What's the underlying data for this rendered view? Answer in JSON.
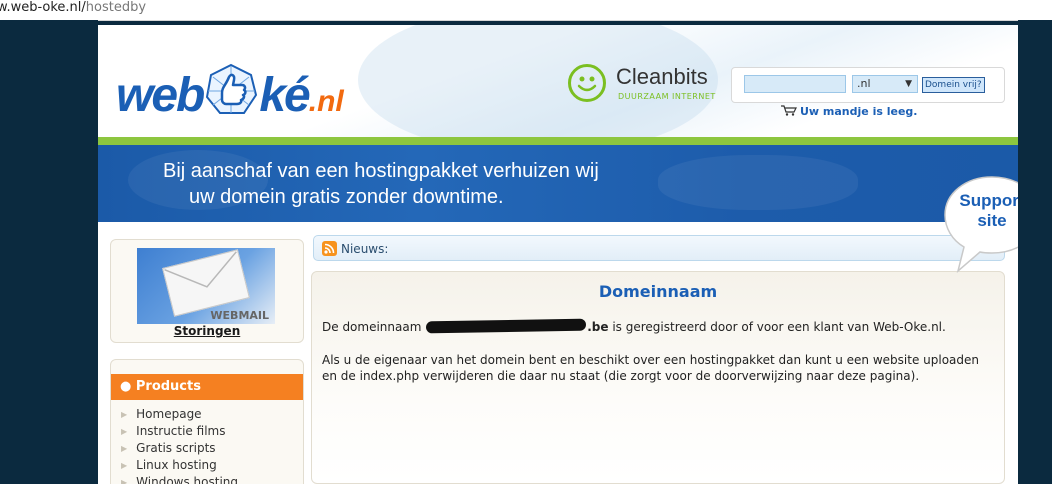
{
  "browser": {
    "url_host": "w.web-oke.nl/",
    "url_path": "hostedby"
  },
  "header": {
    "logo": {
      "part1": "web",
      "part2": "ké",
      "part3": ".nl"
    },
    "cleanbits": {
      "name": "Cleanbits",
      "tagline": "DUURZAAM INTERNET"
    },
    "domain_search": {
      "input_value": "",
      "tld_selected": ".nl",
      "button_label": "Domein vrij?"
    },
    "cart_text": "Uw mandje is leeg."
  },
  "banner": {
    "line1": "Bij aanschaf van een hostingpakket verhuizen wij",
    "line2": "uw domein gratis zonder downtime."
  },
  "support": {
    "line1": "Support",
    "line2": "site"
  },
  "sidebar": {
    "webmail_label": "WEBMAIL",
    "storingen_link": "Storingen",
    "products_title": "Products",
    "products": [
      "Homepage",
      "Instructie films",
      "Gratis scripts",
      "Linux hosting",
      "Windows hosting"
    ]
  },
  "news": {
    "label": "Nieuws:"
  },
  "main": {
    "title": "Domeinnaam",
    "p1_before": "De domeinnaam ",
    "p1_domain_suffix": ".be",
    "p1_after": " is geregistreerd door of voor een klant van Web-Oke.nl.",
    "p2": "Als u de eigenaar van het domein bent en beschikt over een hostingpakket dan kunt u een website uploaden en de index.php verwijderen die daar nu staat (die zorgt voor de doorverwijzing naar deze pagina)."
  },
  "colors": {
    "brand_blue": "#1b5fb5",
    "brand_orange": "#f58021",
    "brand_green": "#8dc63f",
    "background_dark": "#0b2a3f"
  }
}
